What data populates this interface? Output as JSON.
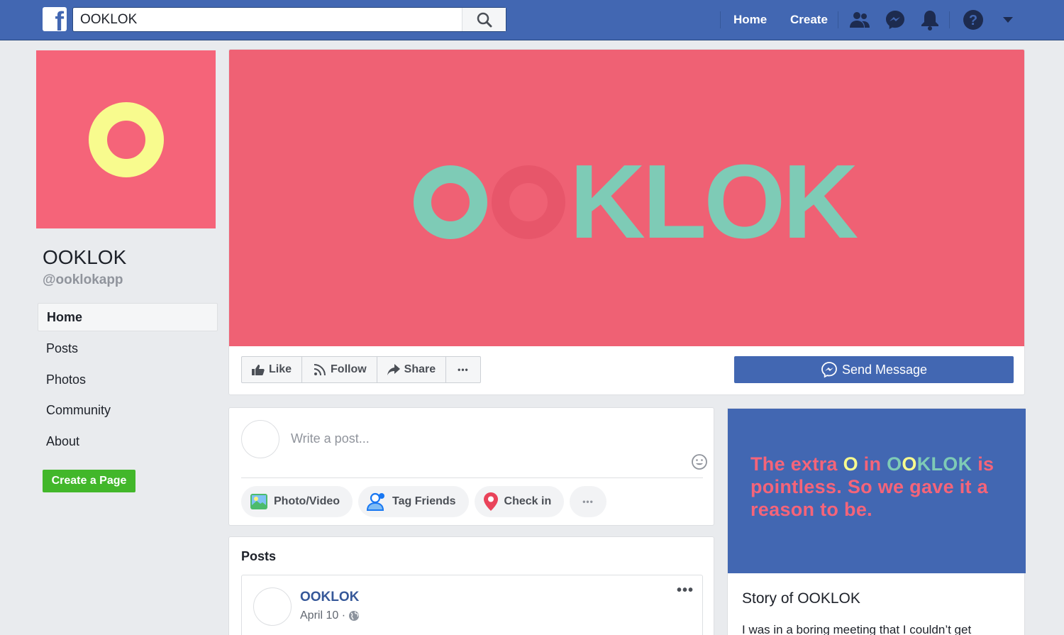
{
  "topbar": {
    "search_value": "OOKLOK",
    "home_label": "Home",
    "create_label": "Create"
  },
  "profile": {
    "name": "OOKLOK",
    "handle": "@ooklokapp"
  },
  "left_nav": {
    "items": [
      {
        "label": "Home",
        "active": true
      },
      {
        "label": "Posts"
      },
      {
        "label": "Photos"
      },
      {
        "label": "Community"
      },
      {
        "label": "About"
      }
    ],
    "create_page_label": "Create a Page"
  },
  "cover": {
    "word_tail": "KLOK"
  },
  "actions": {
    "like": "Like",
    "follow": "Follow",
    "share": "Share",
    "more": "•••",
    "send_message": "Send Message"
  },
  "composer": {
    "placeholder": "Write a post...",
    "photo_video": "Photo/Video",
    "tag_friends": "Tag Friends",
    "check_in": "Check in",
    "more": "•••"
  },
  "posts": {
    "title": "Posts",
    "items": [
      {
        "author": "OOKLOK",
        "date": "April 10 ·",
        "more": "•••"
      }
    ]
  },
  "story": {
    "headline_1": "The extra ",
    "headline_o": "O",
    "headline_2": " in ",
    "headline_oo_1": "O",
    "headline_oo_2": "O",
    "headline_klok": "KLOK",
    "headline_3": " is pointless. So we gave it a reason to be.",
    "title": "Story of OOKLOK",
    "body": "I was in a boring meeting that I couldn’t get"
  },
  "colors": {
    "facebook_blue": "#4267b2",
    "brand_pink": "#f56479",
    "brand_teal": "#7ecbb6",
    "brand_yellow": "#f8fb8e",
    "create_green": "#42b72a"
  }
}
